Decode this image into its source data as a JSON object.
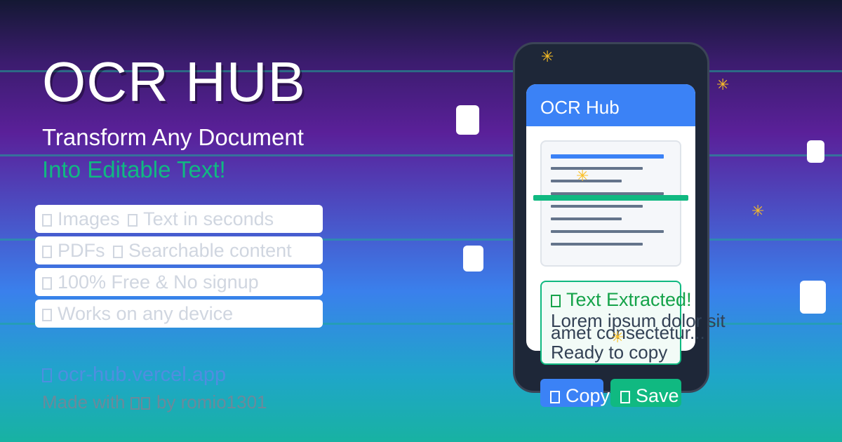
{
  "hero": {
    "title": "OCR HUB",
    "subtitle_line1": "Transform Any Document",
    "subtitle_line2": "Into Editable Text!"
  },
  "features": [
    {
      "from": "Images",
      "to": "Text in seconds"
    },
    {
      "from": "PDFs",
      "to": "Searchable content"
    },
    {
      "text": "100% Free & No signup"
    },
    {
      "text": "Works on any device"
    }
  ],
  "footer": {
    "url": "ocr-hub.vercel.app",
    "made_prefix": "Made with",
    "made_suffix": "by romio1301"
  },
  "phone": {
    "app_title": "OCR Hub",
    "result_title": "Text Extracted!",
    "result_line1": "Lorem ipsum dolor sit",
    "result_line2": "amet consectetur...",
    "result_line3": "Ready to copy",
    "copy_label": "Copy",
    "save_label": "Save"
  },
  "colors": {
    "accent_blue": "#3b82f6",
    "accent_green": "#10b981",
    "sparkle": "#fbbf24"
  }
}
